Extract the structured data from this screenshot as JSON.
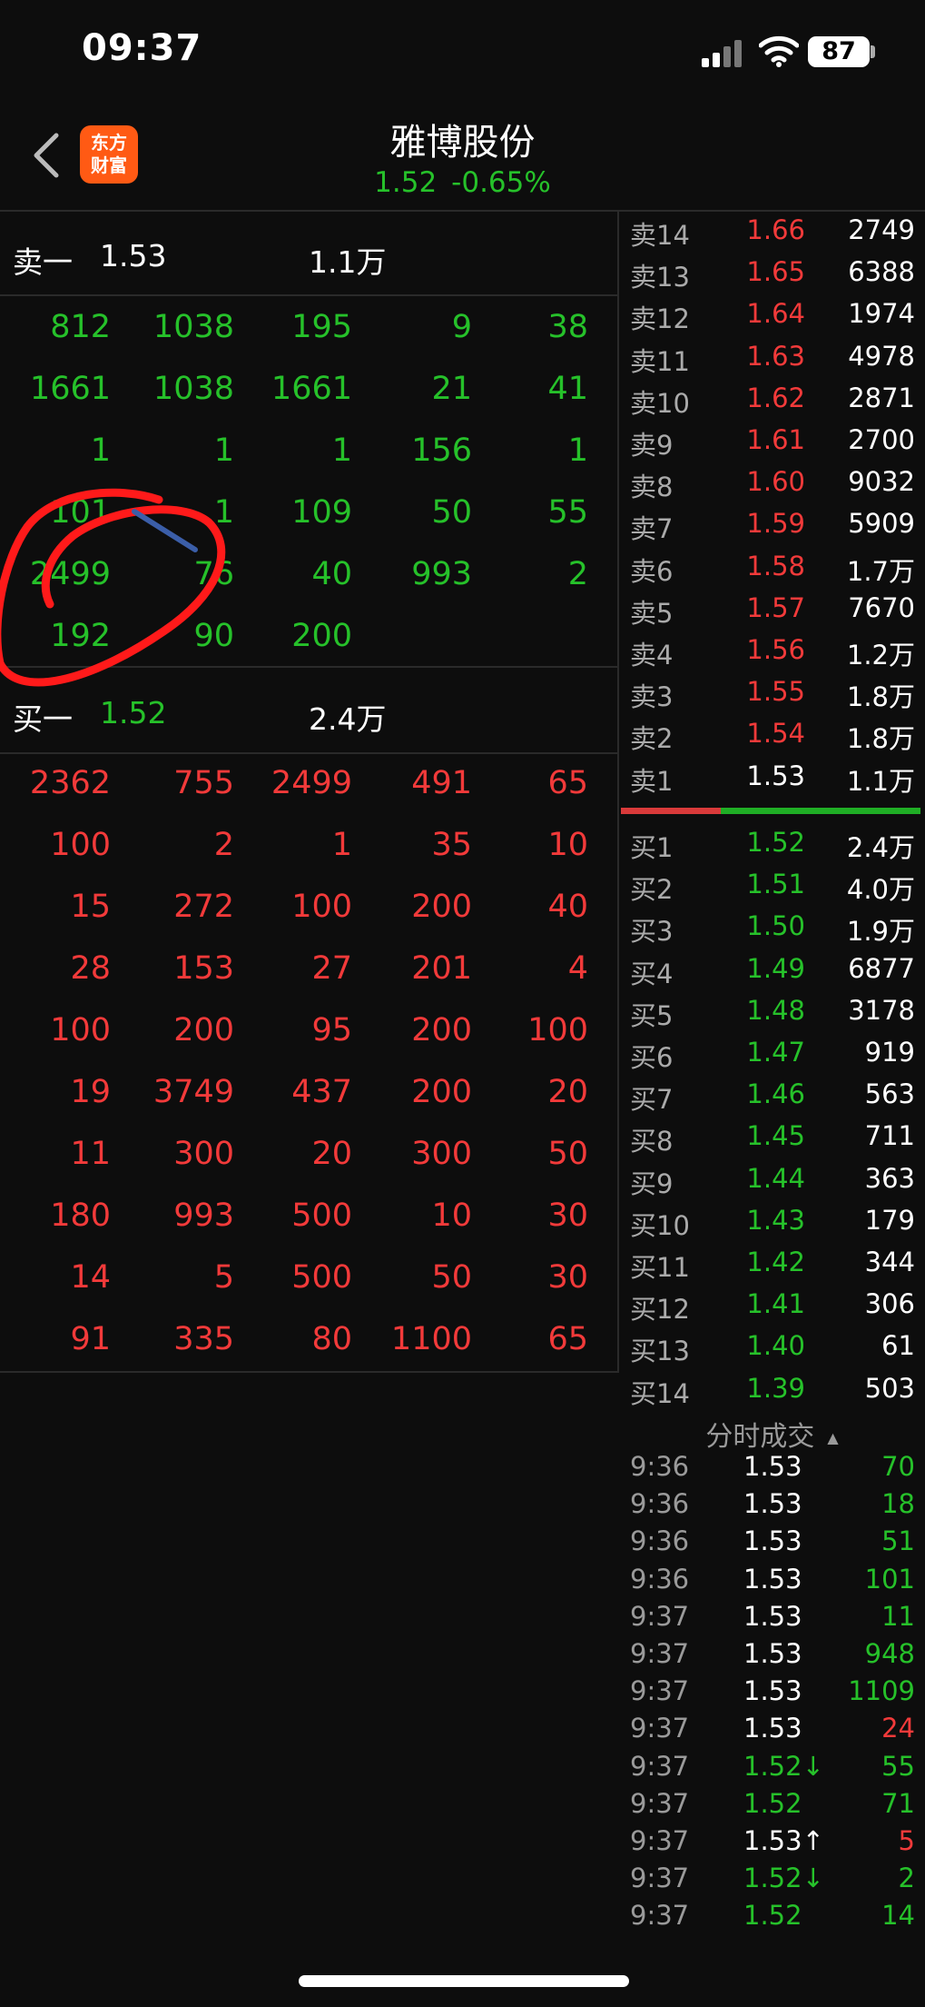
{
  "status_bar": {
    "time": "09:37",
    "battery": "87"
  },
  "header": {
    "logo_line1": "东方",
    "logo_line2": "财富",
    "stock_name": "雅博股份",
    "price": "1.52",
    "change_pct": "-0.65%"
  },
  "sell_summary": {
    "label": "卖一",
    "price": "1.53",
    "volume": "1.1万"
  },
  "buy_summary": {
    "label": "买一",
    "price": "1.52",
    "volume": "2.4万"
  },
  "sell_queue": [
    [
      "812",
      "1038",
      "195",
      "9",
      "38"
    ],
    [
      "1661",
      "1038",
      "1661",
      "21",
      "41"
    ],
    [
      "1",
      "1",
      "1",
      "156",
      "1"
    ],
    [
      "101",
      "1",
      "109",
      "50",
      "55"
    ],
    [
      "2499",
      "76",
      "40",
      "993",
      "2"
    ],
    [
      "192",
      "90",
      "200",
      "",
      ""
    ]
  ],
  "buy_queue": [
    [
      "2362",
      "755",
      "2499",
      "491",
      "65"
    ],
    [
      "100",
      "2",
      "1",
      "35",
      "10"
    ],
    [
      "15",
      "272",
      "100",
      "200",
      "40"
    ],
    [
      "28",
      "153",
      "27",
      "201",
      "4"
    ],
    [
      "100",
      "200",
      "95",
      "200",
      "100"
    ],
    [
      "19",
      "3749",
      "437",
      "200",
      "20"
    ],
    [
      "11",
      "300",
      "20",
      "300",
      "50"
    ],
    [
      "180",
      "993",
      "500",
      "10",
      "30"
    ],
    [
      "14",
      "5",
      "500",
      "50",
      "30"
    ],
    [
      "91",
      "335",
      "80",
      "1100",
      "65"
    ]
  ],
  "sell_levels": [
    {
      "level": "卖14",
      "price": "1.66",
      "volume": "2749",
      "color": "red"
    },
    {
      "level": "卖13",
      "price": "1.65",
      "volume": "6388",
      "color": "red"
    },
    {
      "level": "卖12",
      "price": "1.64",
      "volume": "1974",
      "color": "red"
    },
    {
      "level": "卖11",
      "price": "1.63",
      "volume": "4978",
      "color": "red"
    },
    {
      "level": "卖10",
      "price": "1.62",
      "volume": "2871",
      "color": "red"
    },
    {
      "level": "卖9",
      "price": "1.61",
      "volume": "2700",
      "color": "red"
    },
    {
      "level": "卖8",
      "price": "1.60",
      "volume": "9032",
      "color": "red"
    },
    {
      "level": "卖7",
      "price": "1.59",
      "volume": "5909",
      "color": "red"
    },
    {
      "level": "卖6",
      "price": "1.58",
      "volume": "1.7万",
      "color": "red"
    },
    {
      "level": "卖5",
      "price": "1.57",
      "volume": "7670",
      "color": "red"
    },
    {
      "level": "卖4",
      "price": "1.56",
      "volume": "1.2万",
      "color": "red"
    },
    {
      "level": "卖3",
      "price": "1.55",
      "volume": "1.8万",
      "color": "red"
    },
    {
      "level": "卖2",
      "price": "1.54",
      "volume": "1.8万",
      "color": "red"
    },
    {
      "level": "卖1",
      "price": "1.53",
      "volume": "1.1万",
      "color": "white"
    }
  ],
  "buy_levels": [
    {
      "level": "买1",
      "price": "1.52",
      "volume": "2.4万"
    },
    {
      "level": "买2",
      "price": "1.51",
      "volume": "4.0万"
    },
    {
      "level": "买3",
      "price": "1.50",
      "volume": "1.9万"
    },
    {
      "level": "买4",
      "price": "1.49",
      "volume": "6877"
    },
    {
      "level": "买5",
      "price": "1.48",
      "volume": "3178"
    },
    {
      "level": "买6",
      "price": "1.47",
      "volume": "919"
    },
    {
      "level": "买7",
      "price": "1.46",
      "volume": "563"
    },
    {
      "level": "买8",
      "price": "1.45",
      "volume": "711"
    },
    {
      "level": "买9",
      "price": "1.44",
      "volume": "363"
    },
    {
      "level": "买10",
      "price": "1.43",
      "volume": "179"
    },
    {
      "level": "买11",
      "price": "1.42",
      "volume": "344"
    },
    {
      "level": "买12",
      "price": "1.41",
      "volume": "306"
    },
    {
      "level": "买13",
      "price": "1.40",
      "volume": "61"
    },
    {
      "level": "买14",
      "price": "1.39",
      "volume": "503"
    }
  ],
  "trades_title": "分时成交",
  "trades": [
    {
      "time": "9:36",
      "price": "1.53",
      "price_color": "white",
      "volume": "70",
      "volume_color": "green"
    },
    {
      "time": "9:36",
      "price": "1.53",
      "price_color": "white",
      "volume": "18",
      "volume_color": "green"
    },
    {
      "time": "9:36",
      "price": "1.53",
      "price_color": "white",
      "volume": "51",
      "volume_color": "green"
    },
    {
      "time": "9:36",
      "price": "1.53",
      "price_color": "white",
      "volume": "101",
      "volume_color": "green"
    },
    {
      "time": "9:37",
      "price": "1.53",
      "price_color": "white",
      "volume": "11",
      "volume_color": "green"
    },
    {
      "time": "9:37",
      "price": "1.53",
      "price_color": "white",
      "volume": "948",
      "volume_color": "green"
    },
    {
      "time": "9:37",
      "price": "1.53",
      "price_color": "white",
      "volume": "1109",
      "volume_color": "green"
    },
    {
      "time": "9:37",
      "price": "1.53",
      "price_color": "white",
      "volume": "24",
      "volume_color": "red"
    },
    {
      "time": "9:37",
      "price": "1.52↓",
      "price_color": "green",
      "volume": "55",
      "volume_color": "green"
    },
    {
      "time": "9:37",
      "price": "1.52",
      "price_color": "green",
      "volume": "71",
      "volume_color": "green"
    },
    {
      "time": "9:37",
      "price": "1.53↑",
      "price_color": "white",
      "volume": "5",
      "volume_color": "red"
    },
    {
      "time": "9:37",
      "price": "1.52↓",
      "price_color": "green",
      "volume": "2",
      "volume_color": "green"
    },
    {
      "time": "9:37",
      "price": "1.52",
      "price_color": "green",
      "volume": "14",
      "volume_color": "green"
    }
  ],
  "colors": {
    "red": "#f23a3a",
    "green": "#26c12a",
    "white": "#ffffff",
    "annotation_red": "#ff1a1a",
    "annotation_blue": "#3b5ea8"
  }
}
